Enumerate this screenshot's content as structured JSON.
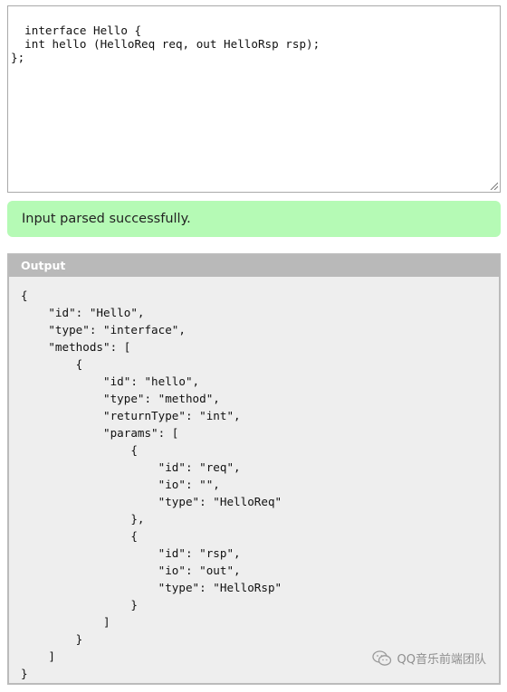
{
  "input": {
    "code": "interface Hello {\n  int hello (HelloReq req, out HelloRsp rsp);\n};"
  },
  "status": {
    "message": "Input parsed successfully.",
    "color": "#b5fab5"
  },
  "output": {
    "title": "Output",
    "json_text": "{\n    \"id\": \"Hello\",\n    \"type\": \"interface\",\n    \"methods\": [\n        {\n            \"id\": \"hello\",\n            \"type\": \"method\",\n            \"returnType\": \"int\",\n            \"params\": [\n                {\n                    \"id\": \"req\",\n                    \"io\": \"\",\n                    \"type\": \"HelloReq\"\n                },\n                {\n                    \"id\": \"rsp\",\n                    \"io\": \"out\",\n                    \"type\": \"HelloRsp\"\n                }\n            ]\n        }\n    ]\n}"
  },
  "watermark": {
    "text": "QQ音乐前端团队",
    "icon": "wechat-icon"
  }
}
